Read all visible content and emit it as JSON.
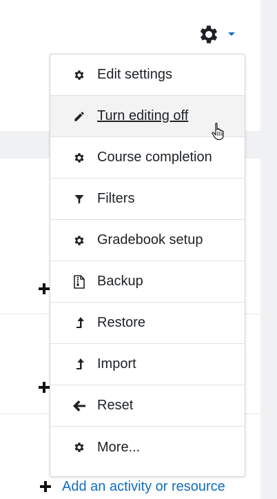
{
  "header": {
    "settings_icon": "gear-icon",
    "dropdown_icon": "caret-down-icon",
    "accent": "#0f6cbf"
  },
  "menu": {
    "items": [
      {
        "label": "Edit settings",
        "icon": "gear-icon"
      },
      {
        "label": "Turn editing off",
        "icon": "pencil-icon",
        "state": "hovered"
      },
      {
        "label": "Course completion",
        "icon": "gear-icon"
      },
      {
        "label": "Filters",
        "icon": "filter-icon"
      },
      {
        "label": "Gradebook setup",
        "icon": "gear-icon"
      },
      {
        "label": "Backup",
        "icon": "file-archive-icon"
      },
      {
        "label": "Restore",
        "icon": "level-up-icon"
      },
      {
        "label": "Import",
        "icon": "level-up-icon"
      },
      {
        "label": "Reset",
        "icon": "arrow-left-icon"
      },
      {
        "label": "More...",
        "icon": "gear-icon"
      }
    ]
  },
  "footer": {
    "add_activity_label": "Add an activity or resource",
    "add_icon": "plus-icon"
  }
}
